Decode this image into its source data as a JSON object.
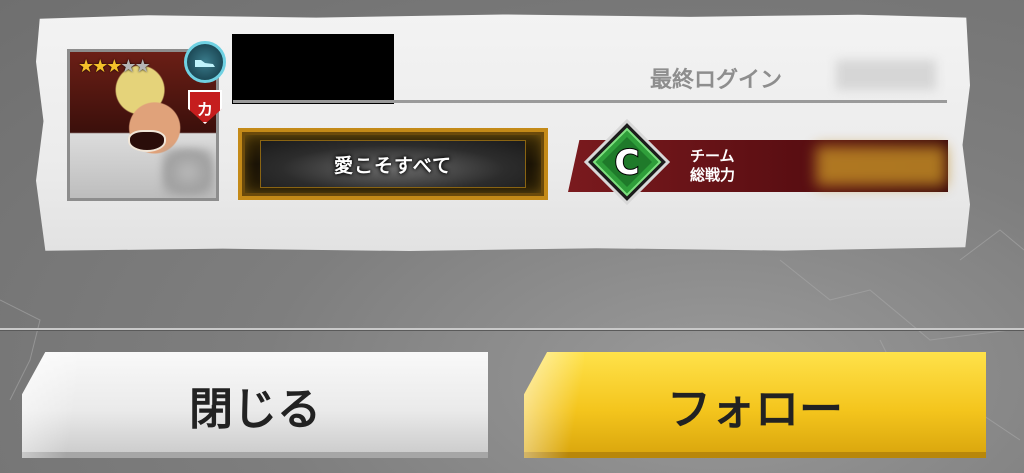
{
  "profile": {
    "stars_filled": 3,
    "stars_total": 5,
    "type_icon": "sneaker-icon",
    "attribute_label": "カ",
    "last_login_label": "最終ログイン",
    "title_plate": "愛こそすべて",
    "team_power_label_line1": "チーム",
    "team_power_label_line2": "総戦力",
    "rank_letter": "C"
  },
  "buttons": {
    "close_label": "閉じる",
    "follow_label": "フォロー"
  },
  "colors": {
    "follow_button": "#f4c51d",
    "close_button": "#eaeaea",
    "power_band": "#7a1a1e",
    "rank_green": "#2f9e3a",
    "title_gold": "#c48a18"
  }
}
